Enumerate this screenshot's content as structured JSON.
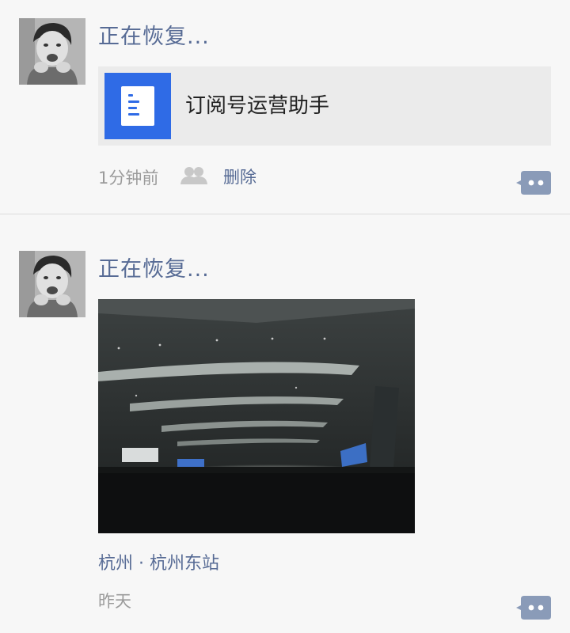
{
  "posts": [
    {
      "username": "正在恢复...",
      "share": {
        "title": "订阅号运营助手",
        "icon": "document-icon",
        "icon_color": "#2f6be6"
      },
      "time": "1分钟前",
      "delete_label": "删除"
    },
    {
      "username": "正在恢复...",
      "photo": "station-hall-photo",
      "location": "杭州 · 杭州东站",
      "time": "昨天"
    }
  ],
  "colors": {
    "link": "#576b95",
    "meta": "#9b9b9b",
    "background": "#f7f7f7",
    "divider": "#dcdcdc"
  }
}
